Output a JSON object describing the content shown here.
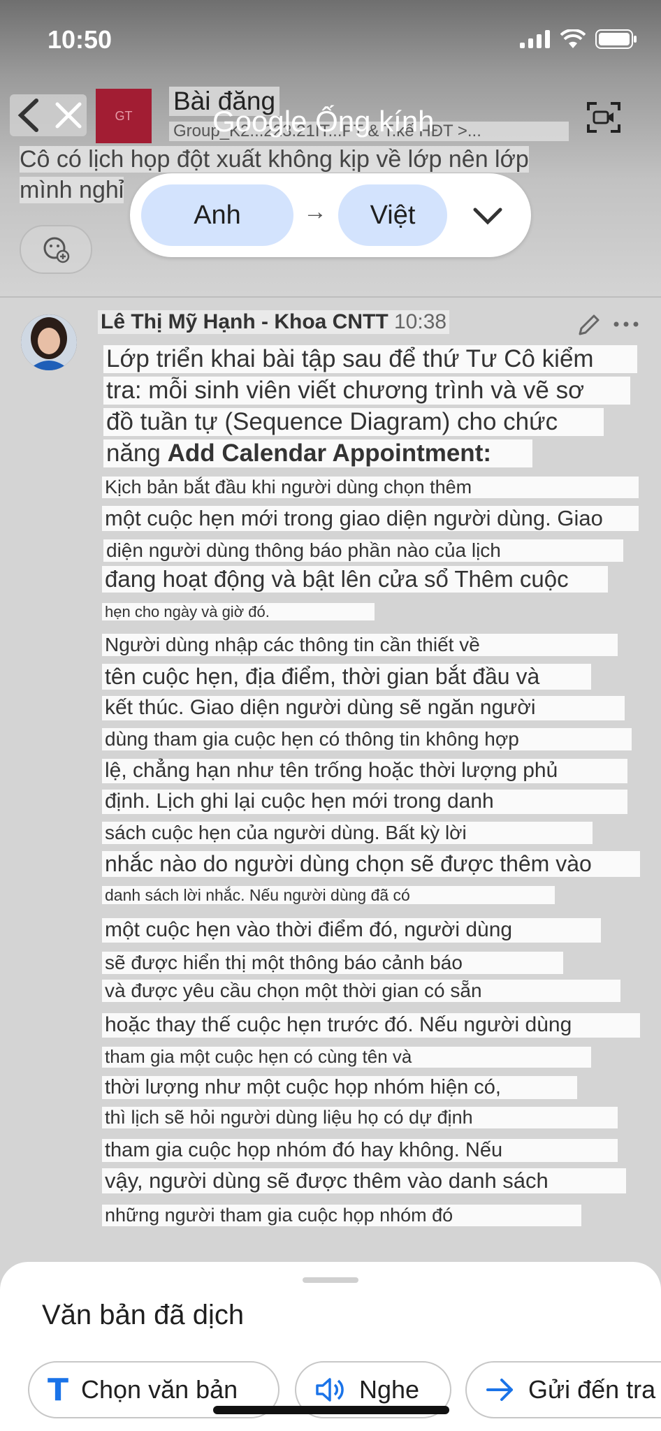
{
  "status": {
    "time": "10:50"
  },
  "header": {
    "post_title": "Bài đăng",
    "post_subtitle": "Group_K2...223.21IT...PT & T.kế HĐT >...",
    "group_initials": "GT",
    "lens_title": "Google Ống kính"
  },
  "previous_comment": {
    "line1": "Cô có lịch họp đột xuất không kịp về lớp nên lớp",
    "line2": "mình nghỉ"
  },
  "language": {
    "from": "Anh",
    "arrow": "→",
    "to": "Việt"
  },
  "comment": {
    "author": "Lê Thị Mỹ Hạnh - Khoa CNTT",
    "time": "10:38",
    "heading_lines": [
      "Lớp triển khai bài tập sau để thứ Tư Cô kiểm",
      "tra: mỗi sinh viên viết chương trình và vẽ sơ",
      "đồ tuần tự (Sequence Diagram) cho chức"
    ],
    "heading_last_prefix": "năng ",
    "heading_last_bold": "Add Calendar Appointment:",
    "lines": [
      "Kịch bản bắt đầu khi người dùng chọn thêm",
      "một cuộc hẹn mới trong giao diện người dùng. Giao",
      "diện người dùng thông báo phần nào của lịch",
      "đang hoạt động và bật lên cửa sổ Thêm cuộc",
      "hẹn cho ngày và giờ đó.",
      "Người dùng nhập các thông tin cần thiết về",
      "tên cuộc hẹn, địa điểm, thời gian bắt đầu và",
      "kết thúc. Giao diện người dùng sẽ ngăn người",
      "dùng tham gia cuộc hẹn có thông tin không hợp",
      "lệ, chẳng hạn như tên trống hoặc thời lượng phủ",
      "định. Lịch ghi lại cuộc hẹn mới trong danh",
      "sách cuộc hẹn của người dùng. Bất kỳ lời",
      "nhắc nào do người dùng chọn sẽ được thêm vào",
      "danh sách lời nhắc. Nếu người dùng đã có",
      "một cuộc hẹn vào thời điểm đó, người dùng",
      "sẽ được hiển thị một thông báo cảnh báo",
      "và được yêu cầu chọn một thời gian có sẵn",
      "hoặc thay thế cuộc hẹn trước đó. Nếu người dùng",
      "tham gia một cuộc hẹn có cùng tên và",
      "thời lượng như một cuộc họp nhóm hiện có,",
      "thì lịch sẽ hỏi người dùng liệu họ có dự định",
      "tham gia cuộc họp nhóm đó hay không. Nếu",
      "vậy, người dùng sẽ được thêm vào danh sách",
      "những người tham gia cuộc họp nhóm đó"
    ]
  },
  "sheet": {
    "title": "Văn bản đã dịch",
    "select_text": "Chọn văn bản",
    "listen": "Nghe",
    "send_to": "Gửi đến tra"
  },
  "colors": {
    "chip_blue": "#d3e3fd",
    "icon_blue": "#1a73e8",
    "group_avatar": "#a21d33"
  }
}
